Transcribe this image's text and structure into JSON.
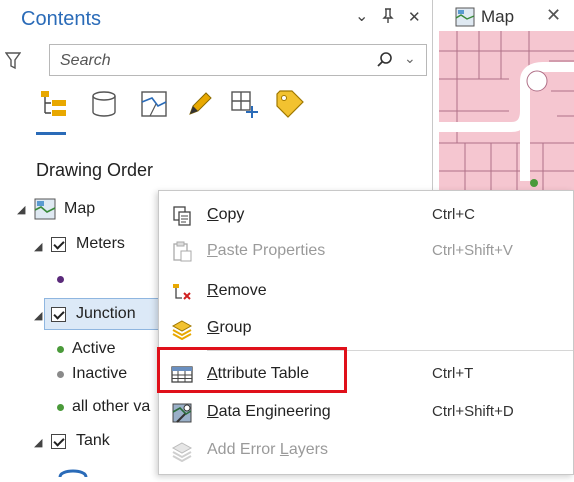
{
  "contents": {
    "title": "Contents",
    "controls": {
      "dropdown": "⌄",
      "pin": "Ԅ",
      "close": "✕"
    },
    "search": {
      "placeholder": "Search",
      "dropdown": "⌄"
    },
    "drawing_order_label": "Drawing Order",
    "tree": {
      "map_label": "Map",
      "meters_label": "Meters",
      "junction_label": "Junction",
      "active_label": "Active",
      "inactive_label": "Inactive",
      "all_other_label": "all other va",
      "tank_label": "Tank"
    },
    "colors": {
      "accent": "#2a6bb8",
      "selection": "#dce9f7",
      "meters_dot": "#5a2a7a",
      "junction_dot": "#4a9a3a"
    }
  },
  "map_view": {
    "tab_label": "Map",
    "tab_close": "✕",
    "colors": {
      "parcel_fill": "#f5c6d0",
      "parcel_line": "#b07088",
      "road": "#ffffff"
    }
  },
  "context_menu": {
    "items": [
      {
        "label": "Copy",
        "mnemonic": "C",
        "rest": "opy",
        "shortcut": "Ctrl+C",
        "enabled": true,
        "icon": "copy-icon"
      },
      {
        "label": "Paste Properties",
        "mnemonic": "P",
        "rest": "aste Properties",
        "shortcut": "Ctrl+Shift+V",
        "enabled": false,
        "icon": "paste-properties-icon"
      },
      {
        "label": "Remove",
        "mnemonic": "R",
        "rest": "emove",
        "shortcut": "",
        "enabled": true,
        "icon": "remove-layer-icon"
      },
      {
        "label": "Group",
        "mnemonic": "G",
        "rest": "roup",
        "shortcut": "",
        "enabled": true,
        "icon": "group-layers-icon"
      },
      {
        "label": "Attribute Table",
        "mnemonic": "A",
        "rest": "ttribute Table",
        "shortcut": "Ctrl+T",
        "enabled": true,
        "icon": "attribute-table-icon"
      },
      {
        "label": "Data Engineering",
        "mnemonic": "D",
        "rest": "ata Engineering",
        "shortcut": "Ctrl+Shift+D",
        "enabled": true,
        "icon": "data-engineering-icon"
      },
      {
        "label": "Add Error Layers",
        "pre": "Add Error ",
        "mnemonic": "L",
        "rest": "ayers",
        "shortcut": "",
        "enabled": false,
        "icon": "add-error-layers-icon"
      }
    ],
    "highlight_color": "#e0101a"
  }
}
